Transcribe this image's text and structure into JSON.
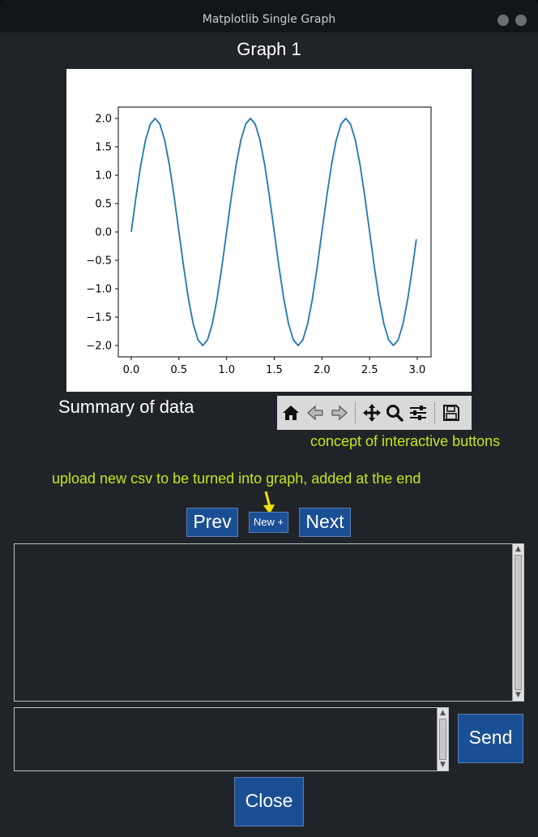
{
  "window": {
    "title": "Matplotlib Single Graph"
  },
  "graph": {
    "title": "Graph 1"
  },
  "summary_label": "Summary of data",
  "chart_data": {
    "type": "line",
    "title": "",
    "xlabel": "",
    "ylabel": "",
    "xlim": [
      0.0,
      3.0
    ],
    "ylim": [
      -2.0,
      2.0
    ],
    "function": "y = 2*sin(2*pi*x)",
    "x_ticks": [
      "0.0",
      "0.5",
      "1.0",
      "1.5",
      "2.0",
      "2.5",
      "3.0"
    ],
    "y_ticks": [
      "2.0",
      "1.5",
      "1.0",
      "0.5",
      "0.0",
      "−0.5",
      "−1.0",
      "−1.5",
      "−2.0"
    ],
    "series": [
      {
        "color": "#1f77b4",
        "x": [
          0.0,
          0.05,
          0.1,
          0.15,
          0.2,
          0.25,
          0.3,
          0.35,
          0.4,
          0.45,
          0.5,
          0.55,
          0.6,
          0.65,
          0.7,
          0.75,
          0.8,
          0.85,
          0.9,
          0.95,
          1.0,
          1.05,
          1.1,
          1.15,
          1.2,
          1.25,
          1.3,
          1.35,
          1.4,
          1.45,
          1.5,
          1.55,
          1.6,
          1.65,
          1.7,
          1.75,
          1.8,
          1.85,
          1.9,
          1.95,
          2.0,
          2.05,
          2.1,
          2.15,
          2.2,
          2.25,
          2.3,
          2.35,
          2.4,
          2.45,
          2.5,
          2.55,
          2.6,
          2.65,
          2.7,
          2.75,
          2.8,
          2.85,
          2.9,
          2.95,
          2.99
        ],
        "y": [
          0.0,
          0.62,
          1.18,
          1.62,
          1.9,
          2.0,
          1.9,
          1.62,
          1.18,
          0.62,
          0.0,
          -0.62,
          -1.18,
          -1.62,
          -1.9,
          -2.0,
          -1.9,
          -1.62,
          -1.18,
          -0.62,
          0.0,
          0.62,
          1.18,
          1.62,
          1.9,
          2.0,
          1.9,
          1.62,
          1.18,
          0.62,
          0.0,
          -0.62,
          -1.18,
          -1.62,
          -1.9,
          -2.0,
          -1.9,
          -1.62,
          -1.18,
          -0.62,
          0.0,
          0.62,
          1.18,
          1.62,
          1.9,
          2.0,
          1.9,
          1.62,
          1.18,
          0.62,
          0.0,
          -0.62,
          -1.18,
          -1.62,
          -1.9,
          -2.0,
          -1.9,
          -1.62,
          -1.18,
          -0.62,
          -0.13
        ]
      }
    ],
    "grid": false
  },
  "toolbar": {
    "icons": [
      "home-icon",
      "back-arrow-icon",
      "forward-arrow-icon",
      "pan-icon",
      "zoom-icon",
      "configure-subplots-icon",
      "save-icon"
    ]
  },
  "notes": {
    "toolbar_note": "concept of interactive buttons",
    "upload_note": "upload new csv to be turned into graph, added at the end",
    "accent_color": "#c5e619",
    "arrow_color": "#f5e400"
  },
  "nav": {
    "prev": "Prev",
    "new": "New +",
    "next": "Next"
  },
  "chat": {
    "send": "Send",
    "close": "Close",
    "output_text": "",
    "input_text": ""
  },
  "colors": {
    "button_bg": "#1a4f94",
    "window_bg": "#202428"
  }
}
